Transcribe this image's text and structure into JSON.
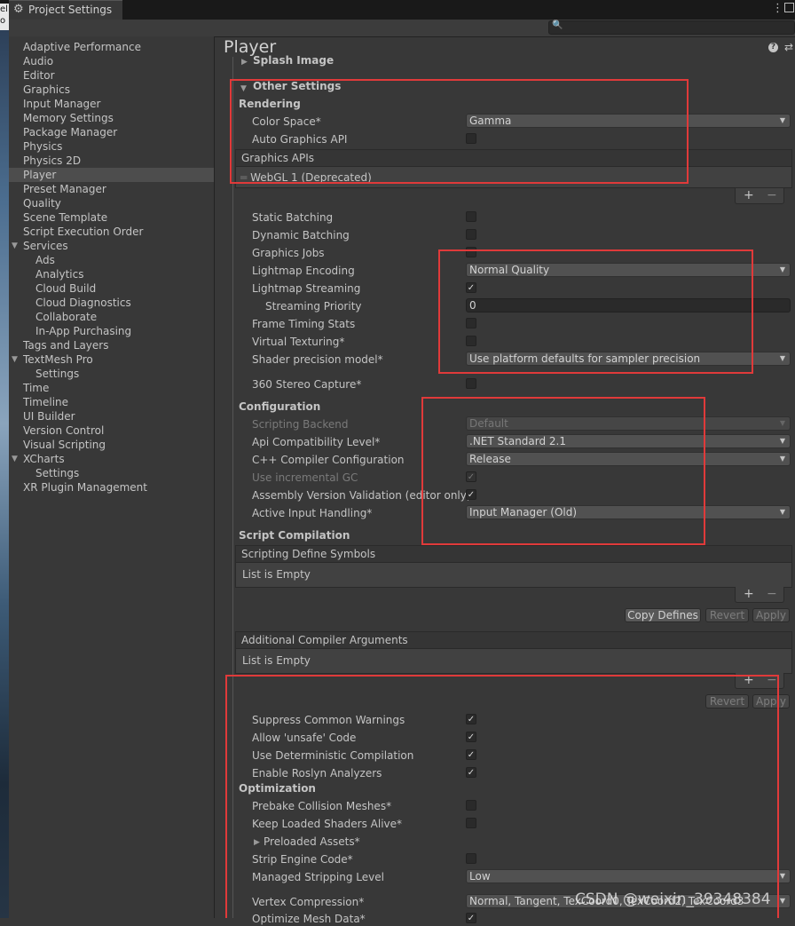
{
  "window": {
    "title": "Project Settings",
    "menu_icon": "kebab-menu-icon"
  },
  "search": {
    "placeholder": ""
  },
  "sidebar": {
    "items": [
      {
        "label": "Adaptive Performance"
      },
      {
        "label": "Audio"
      },
      {
        "label": "Editor"
      },
      {
        "label": "Graphics"
      },
      {
        "label": "Input Manager"
      },
      {
        "label": "Memory Settings"
      },
      {
        "label": "Package Manager"
      },
      {
        "label": "Physics"
      },
      {
        "label": "Physics 2D"
      },
      {
        "label": "Player",
        "selected": true
      },
      {
        "label": "Preset Manager"
      },
      {
        "label": "Quality"
      },
      {
        "label": "Scene Template"
      },
      {
        "label": "Script Execution Order"
      },
      {
        "label": "Services",
        "expanded": true
      },
      {
        "label": "Ads"
      },
      {
        "label": "Analytics"
      },
      {
        "label": "Cloud Build"
      },
      {
        "label": "Cloud Diagnostics"
      },
      {
        "label": "Collaborate"
      },
      {
        "label": "In-App Purchasing"
      },
      {
        "label": "Tags and Layers"
      },
      {
        "label": "TextMesh Pro",
        "expanded": true
      },
      {
        "label": "Settings"
      },
      {
        "label": "Time"
      },
      {
        "label": "Timeline"
      },
      {
        "label": "UI Builder"
      },
      {
        "label": "Version Control"
      },
      {
        "label": "Visual Scripting"
      },
      {
        "label": "XCharts",
        "expanded": true
      },
      {
        "label": "Settings"
      },
      {
        "label": "XR Plugin Management"
      }
    ]
  },
  "panel": {
    "title": "Player",
    "splash_image": "Splash Image",
    "other_settings": "Other Settings",
    "rendering": {
      "heading": "Rendering",
      "color_space_label": "Color Space*",
      "color_space_value": "Gamma",
      "auto_graphics_api_label": "Auto Graphics API",
      "auto_graphics_api": false,
      "graphics_apis_header": "Graphics APIs",
      "graphics_apis_item": "WebGL 1 (Deprecated)",
      "static_batching": "Static Batching",
      "dynamic_batching": "Dynamic Batching",
      "graphics_jobs": "Graphics Jobs",
      "lightmap_encoding_label": "Lightmap Encoding",
      "lightmap_encoding_value": "Normal Quality",
      "lightmap_streaming_label": "Lightmap Streaming",
      "lightmap_streaming": true,
      "streaming_priority_label": "Streaming Priority",
      "streaming_priority_value": "0",
      "frame_timing_stats": "Frame Timing Stats",
      "virtual_texturing": "Virtual Texturing*",
      "shader_precision_label": "Shader precision model*",
      "shader_precision_value": "Use platform defaults for sampler precision",
      "stereo_capture": "360 Stereo Capture*"
    },
    "configuration": {
      "heading": "Configuration",
      "scripting_backend_label": "Scripting Backend",
      "scripting_backend_value": "Default",
      "api_compat_label": "Api Compatibility Level*",
      "api_compat_value": ".NET Standard 2.1",
      "cpp_compiler_label": "C++ Compiler Configuration",
      "cpp_compiler_value": "Release",
      "incremental_gc_label": "Use incremental GC",
      "incremental_gc": true,
      "assembly_validation_label": "Assembly Version Validation (editor only)",
      "assembly_validation": true,
      "active_input_label": "Active Input Handling*",
      "active_input_value": "Input Manager (Old)"
    },
    "script_compilation": {
      "heading": "Script Compilation",
      "define_symbols_header": "Scripting Define Symbols",
      "define_symbols_empty": "List is Empty",
      "copy_defines": "Copy Defines",
      "revert": "Revert",
      "apply": "Apply",
      "compiler_args_header": "Additional Compiler Arguments",
      "compiler_args_empty": "List is Empty",
      "suppress_warnings_label": "Suppress Common Warnings",
      "allow_unsafe_label": "Allow 'unsafe' Code",
      "deterministic_label": "Use Deterministic Compilation",
      "roslyn_label": "Enable Roslyn Analyzers"
    },
    "optimization": {
      "heading": "Optimization",
      "prebake_label": "Prebake Collision Meshes*",
      "keep_shaders_label": "Keep Loaded Shaders Alive*",
      "preloaded_assets_label": "Preloaded Assets*",
      "strip_engine_label": "Strip Engine Code*",
      "stripping_level_label": "Managed Stripping Level",
      "stripping_level_value": "Low",
      "vertex_compression_label": "Vertex Compression*",
      "vertex_compression_value": "Normal, Tangent, TexCoord0, TexCoord2, TexCoord3",
      "optimize_mesh_label": "Optimize Mesh Data*"
    }
  },
  "watermark": "CSDN @weixin_39348384",
  "colors": {
    "annotation_red": "#e03a3a",
    "selected_bg": "#4d4d4d",
    "panel_bg": "#383838"
  }
}
